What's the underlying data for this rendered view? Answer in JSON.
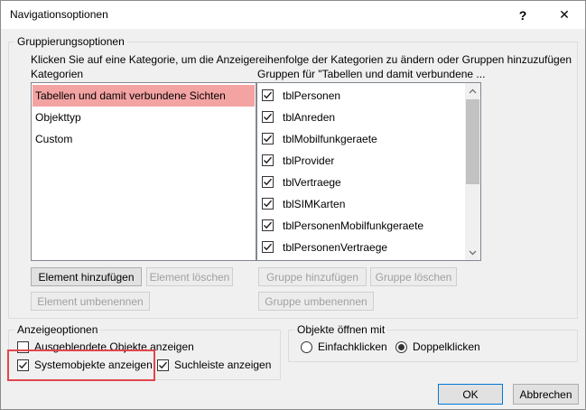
{
  "window": {
    "title": "Navigationsoptionen",
    "help_glyph": "?",
    "close_glyph": "✕"
  },
  "grouping": {
    "legend": "Gruppierungsoptionen",
    "instruction": "Klicken Sie auf eine Kategorie, um die Anzeigereihenfolge der Kategorien zu ändern oder Gruppen hinzuzufügen",
    "categories_label": "Kategorien",
    "groups_label": "Gruppen für \"Tabellen und damit verbundene ...",
    "categories": [
      {
        "label": "Tabellen und damit verbundene Sichten",
        "selected": true
      },
      {
        "label": "Objekttyp",
        "selected": false
      },
      {
        "label": "Custom",
        "selected": false
      }
    ],
    "groups": [
      {
        "label": "tblPersonen",
        "checked": true
      },
      {
        "label": "tblAnreden",
        "checked": true
      },
      {
        "label": "tblMobilfunkgeraete",
        "checked": true
      },
      {
        "label": "tblProvider",
        "checked": true
      },
      {
        "label": "tblVertraege",
        "checked": true
      },
      {
        "label": "tblSIMKarten",
        "checked": true
      },
      {
        "label": "tblPersonenMobilfunkgeraete",
        "checked": true
      },
      {
        "label": "tblPersonenVertraege",
        "checked": true
      }
    ],
    "buttons": {
      "add_element": "Element hinzufügen",
      "delete_element": "Element löschen",
      "rename_element": "Element umbenennen",
      "add_group": "Gruppe hinzufügen",
      "delete_group": "Gruppe löschen",
      "rename_group": "Gruppe umbenennen"
    }
  },
  "display": {
    "legend": "Anzeigeoptionen",
    "show_hidden": {
      "label": "Ausgeblendete Objekte anzeigen",
      "checked": false
    },
    "show_system": {
      "label": "Systemobjekte anzeigen",
      "checked": true
    },
    "show_search": {
      "label": "Suchleiste anzeigen",
      "checked": true
    }
  },
  "open_objects": {
    "legend": "Objekte öffnen mit",
    "single_click": {
      "label": "Einfachklicken",
      "selected": false
    },
    "double_click": {
      "label": "Doppelklicken",
      "selected": true
    }
  },
  "footer": {
    "ok": "OK",
    "cancel": "Abbrechen"
  },
  "colors": {
    "selection": "#f4a3a3",
    "highlight": "#e0474c",
    "default_button_border": "#0078d7"
  }
}
